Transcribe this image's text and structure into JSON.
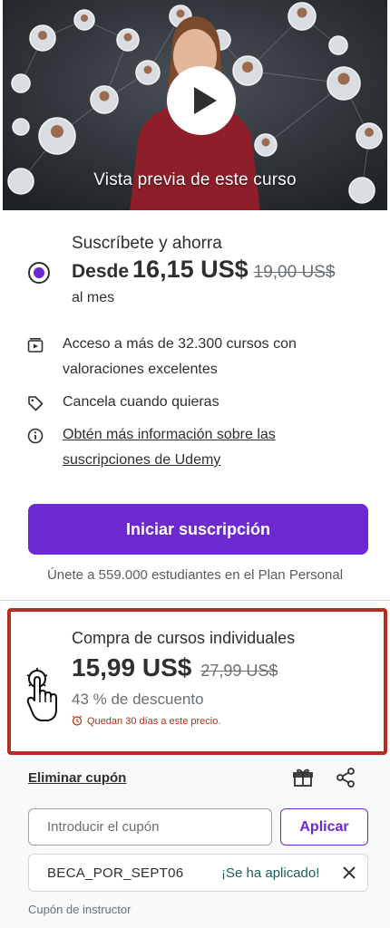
{
  "preview": {
    "caption": "Vista previa de este curso",
    "icon": "play-icon"
  },
  "subscription": {
    "title": "Suscríbete y ahorra",
    "from_label": "Desde",
    "price": "16,15 US$",
    "original_price": "19,00 US$",
    "period": "al mes",
    "selected": true,
    "features": [
      {
        "icon": "library-icon",
        "text": "Acceso a más de 32.300 cursos con valoraciones excelentes"
      },
      {
        "icon": "tag-icon",
        "text": "Cancela cuando quieras"
      },
      {
        "icon": "info-icon",
        "text": "Obtén más información sobre las suscripciones de Udemy"
      }
    ],
    "cta_label": "Iniciar suscripción",
    "join_text": "Únete a 559.000 estudiantes en el Plan Personal"
  },
  "individual": {
    "title": "Compra de cursos individuales",
    "price": "15,99 US$",
    "original_price": "27,99 US$",
    "discount": "43 % de descuento",
    "timer_text": "Quedan 30 días a este precio.",
    "timer_icon": "alarm-clock-icon"
  },
  "coupon": {
    "remove_label": "Eliminar cupón",
    "input_placeholder": "Introducir el cupón",
    "apply_label": "Aplicar",
    "applied_code": "BECA_POR_SEPT06",
    "applied_status": "¡Se ha aplicado!",
    "instructor_label": "Cupón de instructor",
    "gift_icon": "gift-icon",
    "share_icon": "share-icon"
  },
  "colors": {
    "accent": "#6d28d2",
    "highlight_border": "#b52d25",
    "timer": "#b32d0f",
    "success": "#1e6055"
  }
}
